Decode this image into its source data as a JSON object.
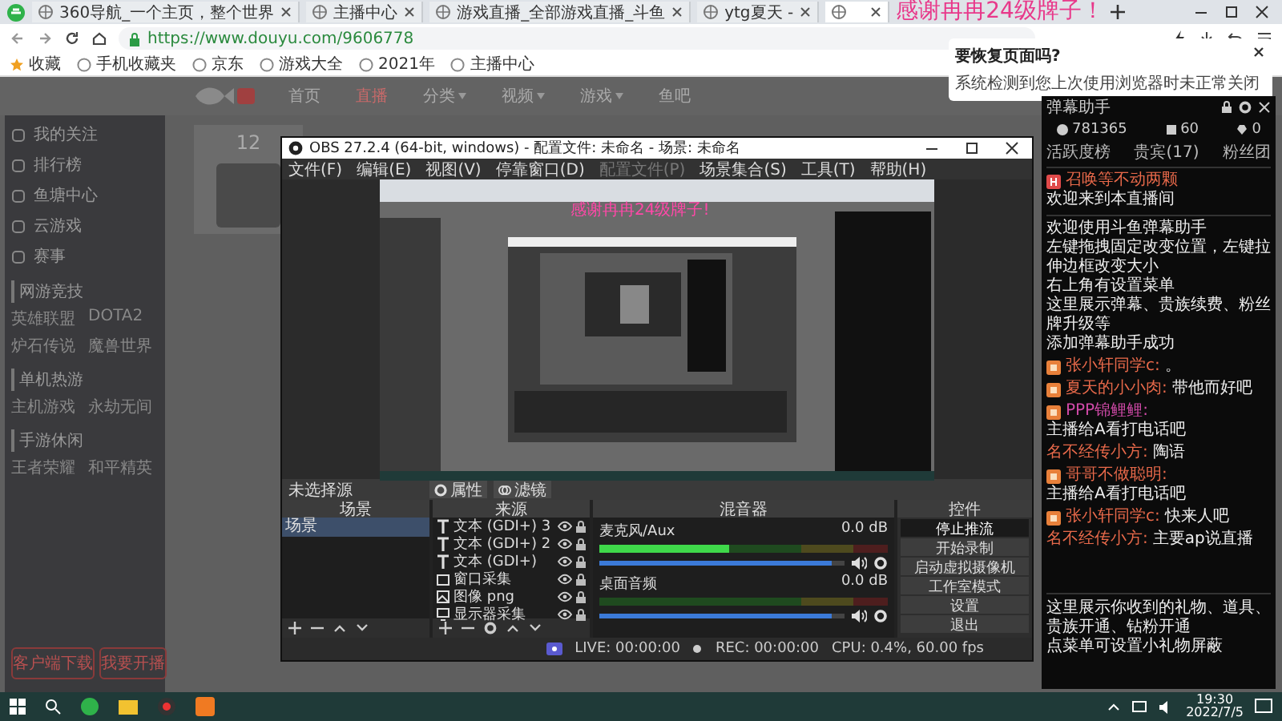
{
  "browser": {
    "tabs": [
      {
        "label": "360导航_一个主页，整个世界",
        "selected": false
      },
      {
        "label": "主播中心",
        "selected": false
      },
      {
        "label": "游戏直播_全部游戏直播_斗鱼",
        "selected": false
      },
      {
        "label": "ytg夏天 -",
        "selected": false
      },
      {
        "selected": true
      }
    ],
    "url": "https://www.douyu.com/9606778",
    "bookmarks": [
      "收藏",
      "手机收藏夹",
      "京东",
      "游戏大全",
      "2021年",
      "主播中心"
    ]
  },
  "overlay_text": "感谢冉冉24级牌子！",
  "restore_popup": {
    "title": "要恢复页面吗?",
    "text": "系统检测到您上次使用浏览器时未正常关闭"
  },
  "site": {
    "nav": [
      {
        "label": "首页",
        "selected": false,
        "dropdown": false
      },
      {
        "label": "直播",
        "selected": true,
        "dropdown": false
      },
      {
        "label": "分类",
        "selected": false,
        "dropdown": true
      },
      {
        "label": "视频",
        "selected": false,
        "dropdown": true
      },
      {
        "label": "游戏",
        "selected": false,
        "dropdown": true
      },
      {
        "label": "鱼吧",
        "selected": false,
        "dropdown": false
      }
    ],
    "count": "12",
    "sidebar": {
      "items": [
        "我的关注",
        "排行榜",
        "鱼塘中心",
        "云游戏",
        "赛事"
      ],
      "sections": [
        {
          "title": "网游竞技",
          "games": [
            "英雄联盟",
            "DOTA2",
            "炉石传说",
            "魔兽世界"
          ]
        },
        {
          "title": "单机热游",
          "games": [
            "主机游戏",
            "永劫无间"
          ]
        },
        {
          "title": "手游休闲",
          "games": [
            "王者荣耀",
            "和平精英"
          ]
        }
      ],
      "buttons": [
        "客户端下载",
        "我要开播"
      ]
    }
  },
  "obs": {
    "title": "OBS 27.2.4 (64-bit, windows) - 配置文件: 未命名 - 场景: 未命名",
    "menu": [
      {
        "label": "文件(F)",
        "disabled": false
      },
      {
        "label": "编辑(E)",
        "disabled": false
      },
      {
        "label": "视图(V)",
        "disabled": false
      },
      {
        "label": "停靠窗口(D)",
        "disabled": false
      },
      {
        "label": "配置文件(P)",
        "disabled": true
      },
      {
        "label": "场景集合(S)",
        "disabled": false
      },
      {
        "label": "工具(T)",
        "disabled": false
      },
      {
        "label": "帮助(H)",
        "disabled": false
      }
    ],
    "preview_overlay_text": "感谢冉冉24级牌子!",
    "source_toolbar": {
      "label": "未选择源",
      "buttons": [
        "属性",
        "滤镜"
      ]
    },
    "docks": {
      "scenes": "场景",
      "sources": "来源",
      "mixer": "混音器",
      "controls": "控件"
    },
    "scenes": [
      {
        "label": "场景",
        "selected": true
      }
    ],
    "sources": [
      {
        "kind": "text",
        "label": "文本 (GDI+) 3"
      },
      {
        "kind": "text",
        "label": "文本 (GDI+) 2"
      },
      {
        "kind": "text",
        "label": "文本 (GDI+)"
      },
      {
        "kind": "window",
        "label": "窗口采集"
      },
      {
        "kind": "image",
        "label": "图像 png"
      },
      {
        "kind": "monitor",
        "label": "显示器采集"
      }
    ],
    "mixer": [
      {
        "name": "麦克风/Aux",
        "reading": "0.0 dB",
        "level": 0.45,
        "volume": {
          "level": 0.95
        },
        "muted": false
      },
      {
        "name": "桌面音频",
        "reading": "0.0 dB",
        "level": 0.0,
        "volume": {
          "level": 0.95
        },
        "muted": false
      }
    ],
    "controls": [
      {
        "label": "停止推流",
        "active": true
      },
      {
        "label": "开始录制",
        "active": false
      },
      {
        "label": "启动虚拟摄像机",
        "active": false
      },
      {
        "label": "工作室模式",
        "active": false
      },
      {
        "label": "设置",
        "active": false
      },
      {
        "label": "退出",
        "active": false
      }
    ],
    "status": [
      "LIVE: 00:00:00",
      "REC: 00:00:00",
      "CPU: 0.4%, 60.00 fps"
    ]
  },
  "chat": {
    "title": "弹幕助手",
    "stats": [
      "781365",
      "60",
      "0"
    ],
    "tabs": [
      {
        "label": "活跃度榜",
        "selected": false
      },
      {
        "label": "贵宾(17)",
        "selected": false
      },
      {
        "label": "粉丝团",
        "selected": false
      }
    ],
    "welcome": {
      "name": "召唤等不动两颗",
      "text": "欢迎来到本直播间"
    },
    "intro": [
      "欢迎使用斗鱼弹幕助手",
      "左键拖拽固定改变位置，左键拉伸边框改变大小",
      "右上角有设置菜单",
      "这里展示弹幕、贵族续费、粉丝牌升级等",
      "添加弹幕助手成功"
    ],
    "messages": [
      {
        "name": "张小轩同学c:",
        "text": "。",
        "badge": true,
        "color": "#e8694a"
      },
      {
        "name": "夏天的小小肉:",
        "text": "带他而好吧",
        "badge": true,
        "color": "#e8694a"
      },
      {
        "name": "PPP锦鲤鲤:",
        "text": "主播给A看打电话吧",
        "badge": true,
        "color": "#d04aa8"
      },
      {
        "name": "名不经传小方:",
        "text": "陶语",
        "badge": false,
        "color": "#e8694a"
      },
      {
        "name": "哥哥不做聪明:",
        "text": "主播给A看打电话吧",
        "badge": true,
        "color": "#e8694a"
      },
      {
        "name": "张小轩同学c:",
        "text": "快来人吧",
        "badge": true,
        "color": "#e8694a"
      },
      {
        "name": "名不经传小方:",
        "text": "主要ap说直播",
        "badge": false,
        "color": "#e8694a"
      }
    ],
    "gift_info": [
      "这里展示你收到的礼物、道具、贵族开通、钻粉开通",
      "点菜单可设置小礼物屏蔽"
    ]
  },
  "taskbar": {
    "time": "19:30",
    "date": "2022/7/5"
  }
}
